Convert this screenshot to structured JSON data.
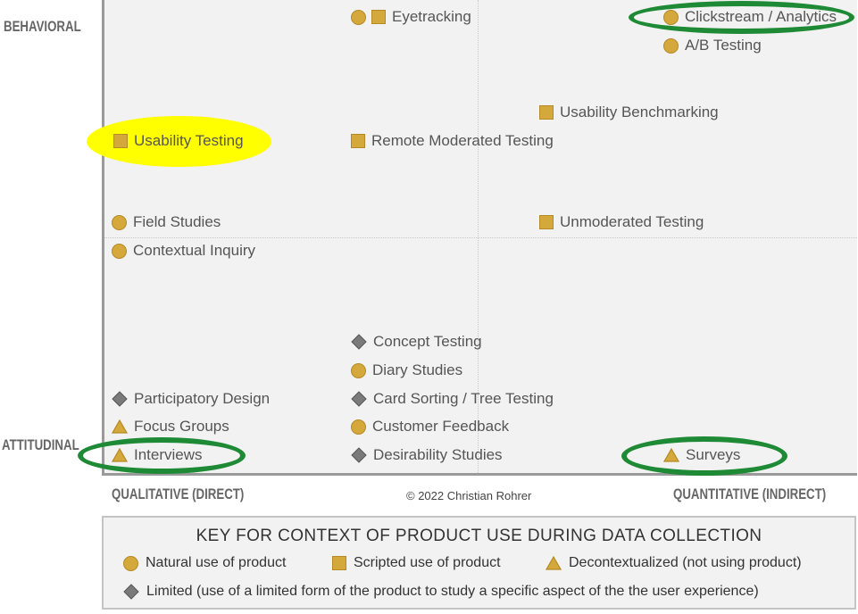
{
  "axes": {
    "behavioral": "BEHAVIORAL",
    "attitudinal": "ATTITUDINAL",
    "qualitative": "QUALITATIVE (DIRECT)",
    "quantitative": "QUANTITATIVE (INDIRECT)"
  },
  "credit": "© 2022 Christian Rohrer",
  "colors": {
    "symbol_fill": "#d4a83a",
    "symbol_edge": "#b58a25",
    "limited_diamond": "#7a7a7a",
    "highlight_yellow": "#ffff00",
    "highlight_green": "#1f8a35"
  },
  "methods": [
    {
      "label": "Eyetracking",
      "symbols": [
        "circle",
        "square"
      ]
    },
    {
      "label": "Clickstream / Analytics",
      "symbols": [
        "circle"
      ]
    },
    {
      "label": "A/B Testing",
      "symbols": [
        "circle"
      ]
    },
    {
      "label": "Usability Benchmarking",
      "symbols": [
        "square"
      ]
    },
    {
      "label": "Usability Testing",
      "symbols": [
        "square"
      ]
    },
    {
      "label": "Remote Moderated Testing",
      "symbols": [
        "square"
      ]
    },
    {
      "label": "Field Studies",
      "symbols": [
        "circle"
      ]
    },
    {
      "label": "Unmoderated Testing",
      "symbols": [
        "square"
      ]
    },
    {
      "label": "Contextual Inquiry",
      "symbols": [
        "circle"
      ]
    },
    {
      "label": "Concept Testing",
      "symbols": [
        "diamond"
      ]
    },
    {
      "label": "Diary Studies",
      "symbols": [
        "circle"
      ]
    },
    {
      "label": "Participatory Design",
      "symbols": [
        "diamond"
      ]
    },
    {
      "label": "Card Sorting / Tree Testing",
      "symbols": [
        "diamond"
      ]
    },
    {
      "label": "Focus Groups",
      "symbols": [
        "triangle"
      ]
    },
    {
      "label": "Customer Feedback",
      "symbols": [
        "circle"
      ]
    },
    {
      "label": "Interviews",
      "symbols": [
        "triangle"
      ]
    },
    {
      "label": "Desirability Studies",
      "symbols": [
        "diamond"
      ]
    },
    {
      "label": "Surveys",
      "symbols": [
        "triangle"
      ]
    }
  ],
  "legend": {
    "title": "KEY FOR CONTEXT OF PRODUCT USE DURING DATA COLLECTION",
    "items": [
      {
        "symbol": "circle",
        "label": "Natural use of product"
      },
      {
        "symbol": "square",
        "label": "Scripted use of product"
      },
      {
        "symbol": "triangle",
        "label": "Decontextualized (not using product)"
      },
      {
        "symbol": "diamond",
        "label": "Limited (use of a limited form of the product to study a specific aspect of the the user experience)"
      }
    ]
  }
}
